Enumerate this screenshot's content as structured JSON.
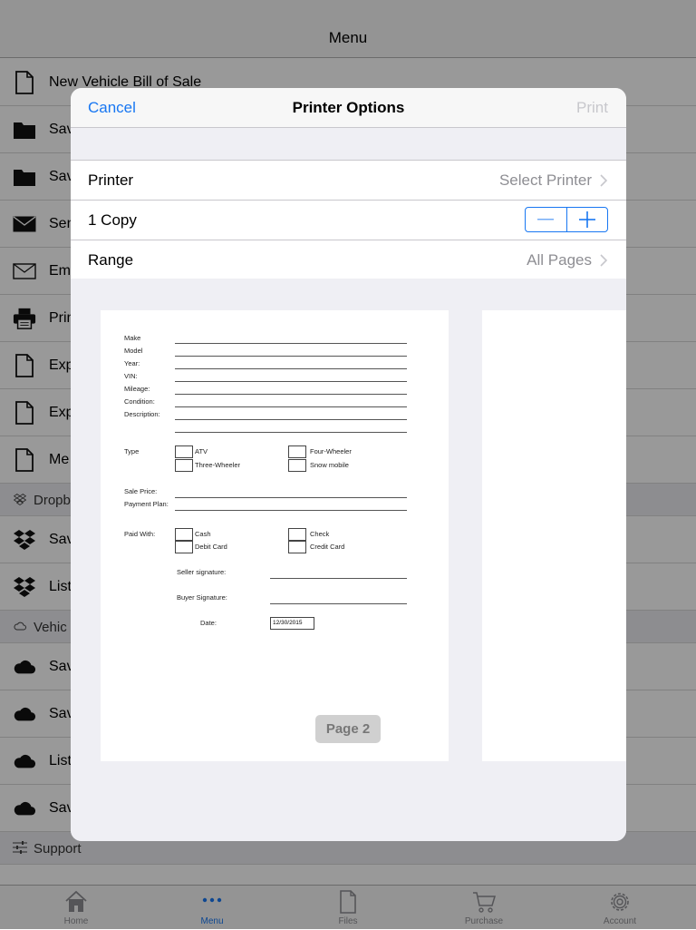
{
  "navbar": {
    "title": "Menu"
  },
  "menu": [
    {
      "type": "row",
      "icon": "document-icon",
      "label": "New Vehicle Bill of Sale"
    },
    {
      "type": "row",
      "icon": "folder-icon",
      "label": "Sav"
    },
    {
      "type": "row",
      "icon": "folder-icon",
      "label": "Sav"
    },
    {
      "type": "row",
      "icon": "envelope-filled-icon",
      "label": "Sen"
    },
    {
      "type": "row",
      "icon": "envelope-outline-icon",
      "label": "Em"
    },
    {
      "type": "row",
      "icon": "printer-icon",
      "label": "Prin"
    },
    {
      "type": "row",
      "icon": "document-icon",
      "label": "Exp"
    },
    {
      "type": "row",
      "icon": "document-icon",
      "label": "Exp"
    },
    {
      "type": "row",
      "icon": "document-icon",
      "label": "Me"
    },
    {
      "type": "section",
      "icon": "dropbox-small-icon",
      "label": "Dropb"
    },
    {
      "type": "row",
      "icon": "dropbox-icon",
      "label": "Sav"
    },
    {
      "type": "row",
      "icon": "dropbox-icon",
      "label": "List"
    },
    {
      "type": "section",
      "icon": "cloud-outline-icon",
      "label": "Vehic"
    },
    {
      "type": "row",
      "icon": "cloud-icon",
      "label": "Sav"
    },
    {
      "type": "row",
      "icon": "cloud-icon",
      "label": "Sav"
    },
    {
      "type": "row",
      "icon": "cloud-icon",
      "label": "List"
    },
    {
      "type": "row",
      "icon": "cloud-icon",
      "label": "Sav"
    },
    {
      "type": "section",
      "icon": "sliders-icon",
      "label": "Support"
    }
  ],
  "tabbar": [
    {
      "label": "Home",
      "icon": "home-icon",
      "active": false
    },
    {
      "label": "Menu",
      "icon": "more-dots-icon",
      "active": true
    },
    {
      "label": "Files",
      "icon": "files-icon",
      "active": false
    },
    {
      "label": "Purchase",
      "icon": "cart-icon",
      "active": false
    },
    {
      "label": "Account",
      "icon": "gear-icon",
      "active": false
    }
  ],
  "modal": {
    "cancel_label": "Cancel",
    "title": "Printer Options",
    "print_label": "Print",
    "printer_label": "Printer",
    "printer_value": "Select Printer",
    "copies_label": "1 Copy",
    "range_label": "Range",
    "range_value": "All Pages"
  },
  "form": {
    "fields": [
      "Make",
      "Model",
      "Year:",
      "VIN:",
      "Mileage:",
      "Condition:",
      "Description:"
    ],
    "type_label": "Type",
    "type_options": [
      "ATV",
      "Three-Wheeler",
      "Four-Wheeler",
      "Snow mobile"
    ],
    "sale_price_label": "Sale Price:",
    "payment_plan_label": "Payment Plan:",
    "paid_with_label": "Paid With:",
    "paid_options": [
      "Cash",
      "Debit Card",
      "Check",
      "Credit Card"
    ],
    "seller_signature_label": "Seller signature:",
    "buyer_signature_label": "Buyer Signature:",
    "date_label": "Date:",
    "date_value": "12/30/2015",
    "page_badge": "Page 2"
  },
  "colors": {
    "accent": "#1877f2",
    "disabled": "#c7c7cc",
    "secondary": "#8e8e93"
  }
}
